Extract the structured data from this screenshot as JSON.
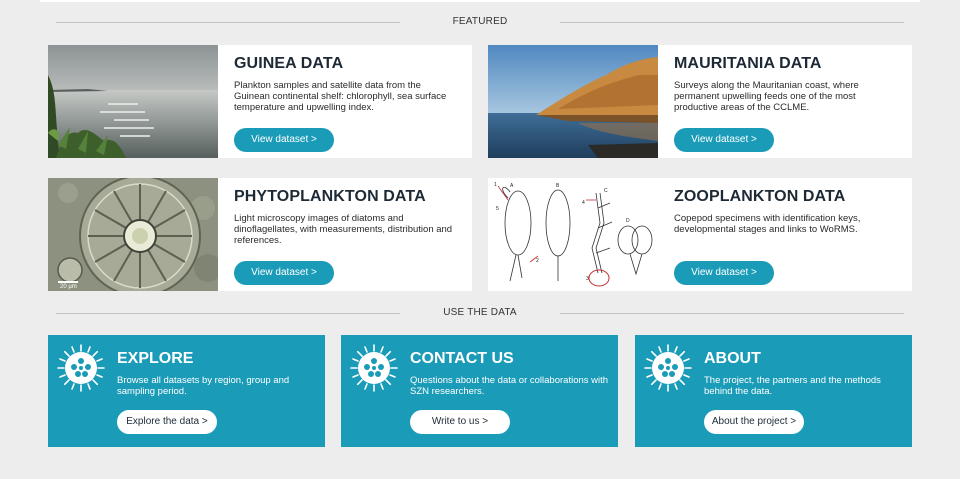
{
  "featured": {
    "heading": "FEATURED",
    "cards": [
      {
        "title": "GUINEA DATA",
        "description": "Plankton samples and satellite data from the Guinean continental shelf: chlorophyll, sea surface temperature and upwelling index.",
        "button": "View dataset >",
        "image": "sea-coast-photo"
      },
      {
        "title": "MAURITANIA DATA",
        "description": "Surveys along the Mauritanian coast, where permanent upwelling feeds one of the most productive areas of the CCLME.",
        "button": "View dataset >",
        "image": "cliff-coast-photo"
      },
      {
        "title": "PHYTOPLANKTON DATA",
        "description": "Light microscopy images of diatoms and dinoflagellates, with measurements, distribution and references.",
        "button": "View dataset >",
        "image": "diatom-micrograph",
        "image_scale_label": "20 µm"
      },
      {
        "title": "ZOOPLANKTON DATA",
        "description": "Copepod specimens with identification keys, developmental stages and links to WoRMS.",
        "button": "View dataset >",
        "image": "copepod-drawing",
        "image_labels": [
          "A",
          "B",
          "C",
          "D",
          "1",
          "2",
          "3",
          "4",
          "5"
        ]
      }
    ]
  },
  "use_data": {
    "heading": "USE THE DATA",
    "actions": [
      {
        "title": "EXPLORE",
        "description": "Browse all datasets by region, group and sampling period.",
        "button": "Explore the data >",
        "icon": "plankton-cell-icon"
      },
      {
        "title": "CONTACT US",
        "description": "Questions about the data or collaborations with SZN researchers.",
        "button": "Write to us >",
        "icon": "plankton-cell-icon"
      },
      {
        "title": "ABOUT",
        "description": "The project, the partners and the methods behind the data.",
        "button": "About the project >",
        "icon": "plankton-cell-icon"
      }
    ]
  },
  "colors": {
    "accent": "#1a9bb7",
    "page_background": "#ededed",
    "card_background": "#ffffff",
    "title_text": "#1d2a36"
  }
}
